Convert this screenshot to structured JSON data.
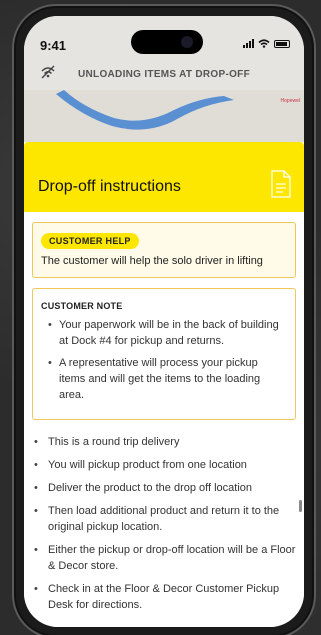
{
  "status_bar": {
    "time": "9:41"
  },
  "header": {
    "title": "UNLOADING ITEMS AT DROP-OFF",
    "icon": "no-signal-icon"
  },
  "map": {
    "label": "Hopewel"
  },
  "sheet": {
    "title": "Drop-off instructions",
    "icon": "document-icon",
    "accent": "#fde600"
  },
  "customer_help": {
    "badge": "CUSTOMER HELP",
    "text": "The customer will help the solo driver in lifting"
  },
  "customer_note": {
    "title": "CUSTOMER NOTE",
    "items": [
      "Your paperwork will be in the back of building at Dock #4 for pickup and returns.",
      "A representative will process your pickup items and will get the items to the loading area."
    ]
  },
  "instructions": [
    "This is a round trip delivery",
    "You will pickup product from one location",
    "Deliver the product to the drop off location",
    "Then load additional product and return it to the original pickup location.",
    "Either the pickup or drop-off location will be a Floor & Decor store.",
    "Check in at the Floor & Decor Customer Pickup Desk for directions."
  ]
}
